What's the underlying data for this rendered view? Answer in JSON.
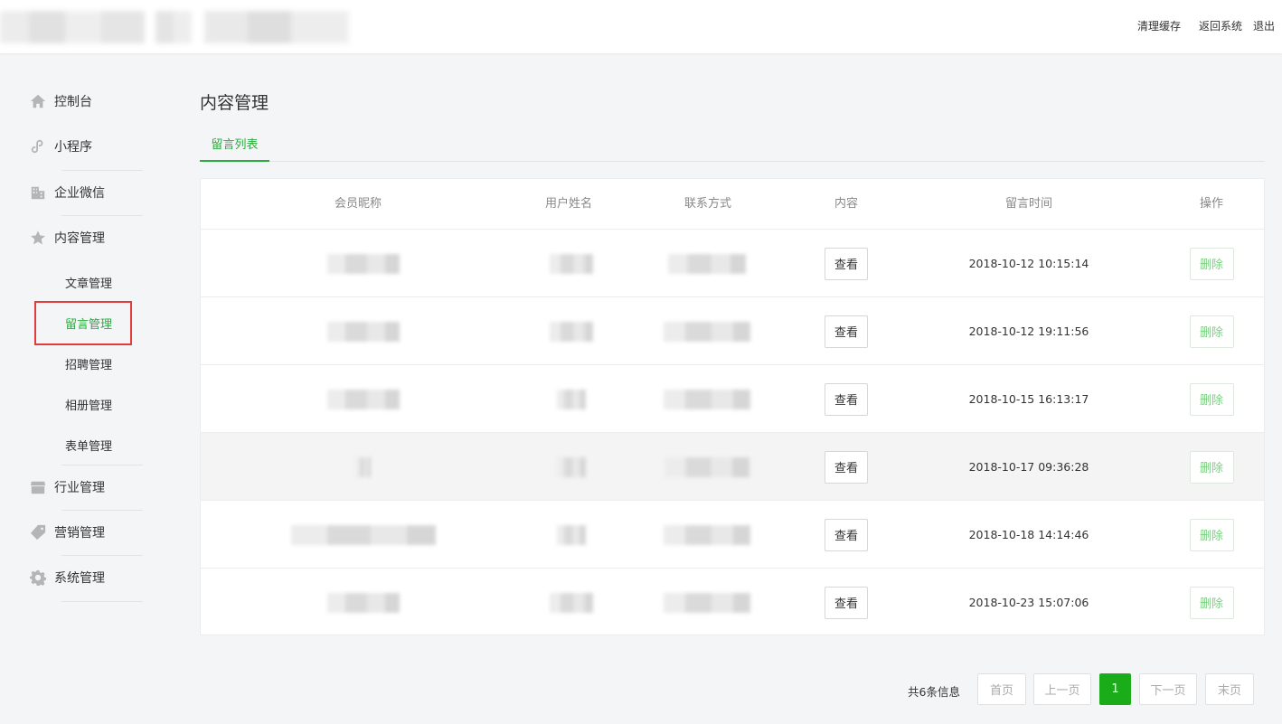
{
  "header": {
    "links": [
      "清理缓存",
      "返回系统",
      "退出"
    ]
  },
  "sidebar": {
    "items": [
      {
        "label": "控制台",
        "icon": "home-icon"
      },
      {
        "label": "小程序",
        "icon": "link-icon"
      },
      {
        "label": "企业微信",
        "icon": "building-icon"
      },
      {
        "label": "内容管理",
        "icon": "star-icon"
      },
      {
        "label": "行业管理",
        "icon": "store-icon"
      },
      {
        "label": "营销管理",
        "icon": "tag-icon"
      },
      {
        "label": "系统管理",
        "icon": "gear-icon"
      }
    ],
    "sub_items": [
      "文章管理",
      "留言管理",
      "招聘管理",
      "相册管理",
      "表单管理"
    ],
    "active_sub": "留言管理"
  },
  "main": {
    "title": "内容管理",
    "tab": "留言列表",
    "columns": [
      "会员昵称",
      "用户姓名",
      "联系方式",
      "内容",
      "留言时间",
      "操作"
    ],
    "view_label": "查看",
    "delete_label": "删除",
    "rows": [
      {
        "time": "2018-10-12 10:15:14"
      },
      {
        "time": "2018-10-12 19:11:56"
      },
      {
        "time": "2018-10-15 16:13:17"
      },
      {
        "time": "2018-10-17 09:36:28"
      },
      {
        "time": "2018-10-18 14:14:46"
      },
      {
        "time": "2018-10-23 15:07:06"
      }
    ]
  },
  "pagination": {
    "info": "共6条信息",
    "first": "首页",
    "prev": "上一页",
    "current": "1",
    "next": "下一页",
    "last": "末页"
  },
  "colors": {
    "accent": "#2aab3d",
    "highlight_box": "#e33b3b",
    "current_page": "#1aad19"
  }
}
